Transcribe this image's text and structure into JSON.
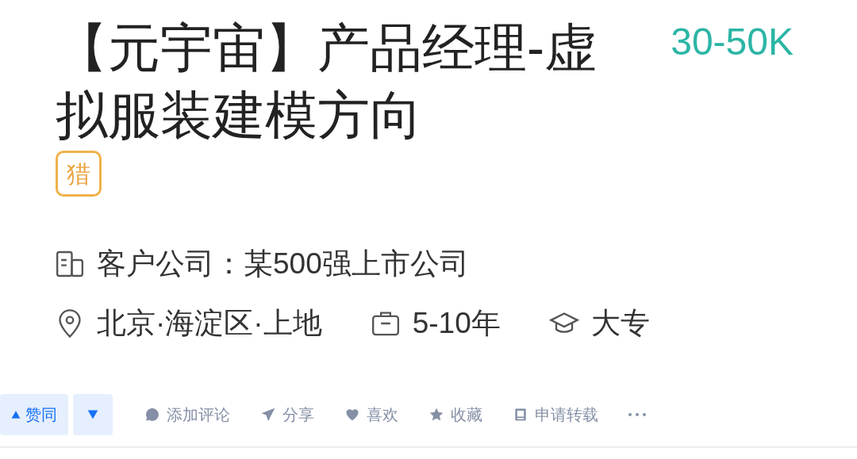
{
  "job": {
    "title": "【元宇宙】产品经理-虚拟服装建模方向",
    "salary": "30-50K",
    "tag": "猎"
  },
  "meta_rows": [
    [
      {
        "kind": "building",
        "text": "客户公司：某500强上市公司"
      }
    ],
    [
      {
        "kind": "location",
        "text": "北京·海淀区·上地"
      },
      {
        "kind": "briefcase",
        "text": "5-10年"
      },
      {
        "kind": "graduation",
        "text": "大专"
      }
    ]
  ],
  "vote": {
    "up_label": "赞同"
  },
  "actions": [
    {
      "kind": "comment",
      "label": "添加评论"
    },
    {
      "kind": "share",
      "label": "分享"
    },
    {
      "kind": "heart",
      "label": "喜欢"
    },
    {
      "kind": "star",
      "label": "收藏"
    },
    {
      "kind": "repost",
      "label": "申请转载"
    },
    {
      "kind": "more"
    }
  ]
}
